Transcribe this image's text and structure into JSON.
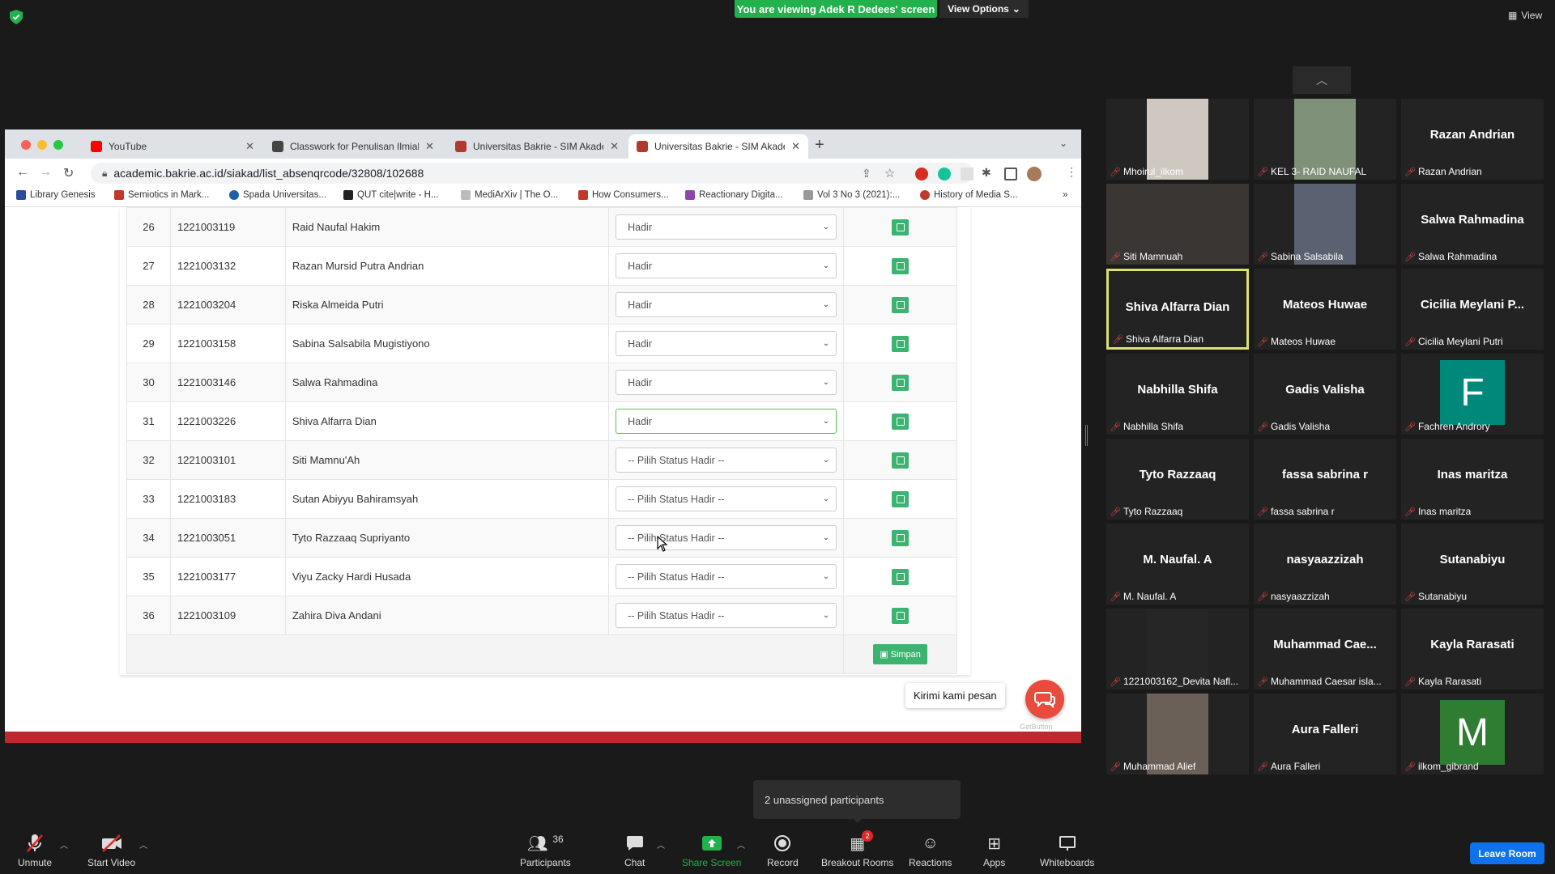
{
  "zoom": {
    "banner": "You are viewing Adek R Dedees' screen",
    "view_options": "View Options",
    "view_label": "View",
    "unassigned_popup": "2 unassigned participants",
    "toolbar": {
      "unmute": "Unmute",
      "start_video": "Start Video",
      "participants": "Participants",
      "participants_count": "36",
      "chat": "Chat",
      "share_screen": "Share Screen",
      "record": "Record",
      "breakout_rooms": "Breakout Rooms",
      "breakout_badge": "2",
      "reactions": "Reactions",
      "apps": "Apps",
      "whiteboards": "Whiteboards",
      "leave_room": "Leave Room"
    },
    "colors": {
      "share_green": "#23b14d",
      "leave_blue": "#0e72ed",
      "speaking_border": "#dbe26b",
      "muted_red": "#e04444"
    }
  },
  "browser": {
    "tabs": [
      {
        "label": "YouTube",
        "icon": "youtube-icon"
      },
      {
        "label": "Classwork for Penulisan Ilmiah",
        "icon": "classroom-icon"
      },
      {
        "label": "Universitas Bakrie - SIM Akade",
        "icon": "bakrie-shield-icon"
      },
      {
        "label": "Universitas Bakrie - SIM Akade",
        "icon": "bakrie-shield-icon"
      }
    ],
    "url_host": "academic.bakrie.ac.id",
    "url_path": "/siakad/list_absenqrcode/32808/102688",
    "bookmarks": [
      "Library Genesis",
      "Semiotics in Mark...",
      "Spada Universitas...",
      "QUT cite|write - H...",
      "MediArXiv | The O...",
      "How Consumers...",
      "Reactionary Digita...",
      "Vol 3 No 3 (2021):...",
      "History of Media S..."
    ],
    "bookmarks_more": "»"
  },
  "attendance": {
    "rows": [
      {
        "no": "26",
        "nim": "1221003119",
        "nama": "Raid Naufal Hakim",
        "status": "Hadir"
      },
      {
        "no": "27",
        "nim": "1221003132",
        "nama": "Razan Mursid Putra Andrian",
        "status": "Hadir"
      },
      {
        "no": "28",
        "nim": "1221003204",
        "nama": "Riska Almeida Putri",
        "status": "Hadir"
      },
      {
        "no": "29",
        "nim": "1221003158",
        "nama": "Sabina Salsabila Mugistiyono",
        "status": "Hadir"
      },
      {
        "no": "30",
        "nim": "1221003146",
        "nama": "Salwa Rahmadina",
        "status": "Hadir"
      },
      {
        "no": "31",
        "nim": "1221003226",
        "nama": "Shiva Alfarra Dian",
        "status": "Hadir"
      },
      {
        "no": "32",
        "nim": "1221003101",
        "nama": "Siti Mamnu'Ah",
        "status": "-- Pilih Status Hadir --"
      },
      {
        "no": "33",
        "nim": "1221003183",
        "nama": "Sutan Abiyyu Bahiramsyah",
        "status": "-- Pilih Status Hadir --"
      },
      {
        "no": "34",
        "nim": "1221003051",
        "nama": "Tyto Razzaaq Supriyanto",
        "status": "-- Pilih Status Hadir --"
      },
      {
        "no": "35",
        "nim": "1221003177",
        "nama": "Viyu Zacky Hardi Husada",
        "status": "-- Pilih Status Hadir --"
      },
      {
        "no": "36",
        "nim": "1221003109",
        "nama": "Zahira Diva Andani",
        "status": "-- Pilih Status Hadir --"
      }
    ],
    "simpan_label": "Simpan",
    "chat_tip": "Kirimi kami pesan",
    "getbutton": "GetButton"
  },
  "gallery": [
    {
      "label": "Mhoirul_ilkom",
      "big": "",
      "kind": "photo",
      "color": "#cfc8c0"
    },
    {
      "label": "KEL 3- RAID NAUFAL",
      "big": "",
      "kind": "photo",
      "color": "#7f9178"
    },
    {
      "label": "Razan Andrian",
      "big": "Razan Andrian",
      "kind": "name"
    },
    {
      "label": "Siti Mamnuah",
      "big": "",
      "kind": "photo-wide",
      "color": "#3a3634"
    },
    {
      "label": "Sabina Salsabila",
      "big": "",
      "kind": "photo",
      "color": "#5a6170"
    },
    {
      "label": "Salwa Rahmadina",
      "big": "Salwa Rahmadina",
      "kind": "name"
    },
    {
      "label": "Shiva Alfarra Dian",
      "big": "Shiva Alfarra Dian",
      "kind": "name",
      "speaking": true
    },
    {
      "label": "Mateos Huwae",
      "big": "Mateos Huwae",
      "kind": "name"
    },
    {
      "label": "Cicilia Meylani Putri",
      "big": "Cicilia Meylani P...",
      "kind": "name"
    },
    {
      "label": "Nabhilla Shifa",
      "big": "Nabhilla Shifa",
      "kind": "name"
    },
    {
      "label": "Gadis Valisha",
      "big": "Gadis Valisha",
      "kind": "name"
    },
    {
      "label": "Fachren Androry",
      "big": "F",
      "kind": "letter",
      "color": "#00897b"
    },
    {
      "label": "Tyto Razzaaq",
      "big": "Tyto Razzaaq",
      "kind": "name"
    },
    {
      "label": "fassa sabrina r",
      "big": "fassa sabrina r",
      "kind": "name"
    },
    {
      "label": "Inas maritza",
      "big": "Inas maritza",
      "kind": "name"
    },
    {
      "label": "M. Naufal. A",
      "big": "M. Naufal. A",
      "kind": "name"
    },
    {
      "label": "nasyaazzizah",
      "big": "nasyaazzizah",
      "kind": "name"
    },
    {
      "label": "Sutanabiyu",
      "big": "Sutanabiyu",
      "kind": "name"
    },
    {
      "label": "1221003162_Devita Nafl...",
      "big": "",
      "kind": "photo",
      "color": "#262626"
    },
    {
      "label": "Muhammad Caesar isla...",
      "big": "Muhammad Cae...",
      "kind": "name"
    },
    {
      "label": "Kayla Rarasati",
      "big": "Kayla Rarasati",
      "kind": "name"
    },
    {
      "label": "Muhammad Alief",
      "big": "",
      "kind": "photo",
      "color": "#6b6058"
    },
    {
      "label": "Aura Falleri",
      "big": "Aura Falleri",
      "kind": "name"
    },
    {
      "label": "ilkom_gibrand",
      "big": "M",
      "kind": "letter",
      "color": "#2e7d32"
    }
  ]
}
